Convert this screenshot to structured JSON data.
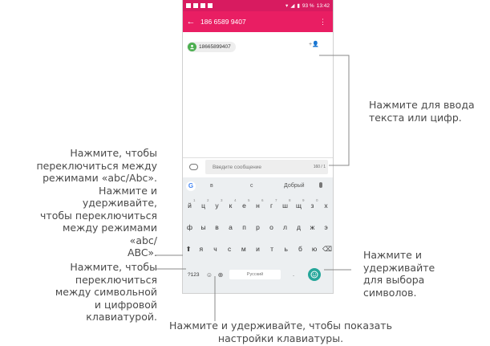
{
  "phone": {
    "status": {
      "battery": "93 %",
      "time": "13:42"
    },
    "appbar": {
      "title": "186 6589 9407",
      "back": "←",
      "menu": "⋮"
    },
    "recipient": {
      "number": "18665899407",
      "add_icon": "+👤"
    },
    "compose": {
      "placeholder": "Введите сообщение",
      "counter": "160 / 1"
    },
    "keyboard": {
      "suggestions": [
        "в",
        "с",
        "Добрый"
      ],
      "row1": [
        {
          "k": "й",
          "s": "1"
        },
        {
          "k": "ц",
          "s": "2"
        },
        {
          "k": "у",
          "s": "3"
        },
        {
          "k": "к",
          "s": "4"
        },
        {
          "k": "е",
          "s": "5"
        },
        {
          "k": "н",
          "s": "6"
        },
        {
          "k": "г",
          "s": "7"
        },
        {
          "k": "ш",
          "s": "8"
        },
        {
          "k": "щ",
          "s": "9"
        },
        {
          "k": "з",
          "s": "0"
        },
        {
          "k": "х",
          "s": ""
        }
      ],
      "row2": [
        "ф",
        "ы",
        "в",
        "а",
        "п",
        "р",
        "о",
        "л",
        "д",
        "ж",
        "э"
      ],
      "row3": [
        "я",
        "ч",
        "с",
        "м",
        "и",
        "т",
        "ь",
        "б",
        "ю"
      ],
      "symbols_key": "?123",
      "space_label": "Русский",
      "period": "."
    }
  },
  "callouts": {
    "right_top": "Нажмите для ввода\nтекста или цифр.",
    "left_top": "Нажмите, чтобы\nпереключиться между\nрежимами «abc/Abc».\nНажмите и удерживайте,\nчтобы переключиться\nмежду режимами «abc/\nABC».",
    "left_bottom": "Нажмите, чтобы\nпереключиться\nмежду символьной\nи цифровой\nклавиатурой.",
    "right_bottom": "Нажмите и\nудерживайте\nдля выбора\nсимволов.",
    "bottom": "Нажмите и удерживайте, чтобы показать\nнастройки клавиатуры."
  },
  "colors": {
    "statusbar": "#d81b60",
    "appbar": "#e91e63",
    "avatar": "#4caf50",
    "emoji_key": "#26a69a"
  },
  "icons": {
    "back": "arrow-back-icon",
    "menu": "more-vert-icon",
    "avatar": "person-icon",
    "add_contact": "add-contact-icon",
    "attach": "attachment-icon",
    "mic": "mic-icon",
    "shift": "shift-icon",
    "backspace": "backspace-icon",
    "settings": "mic-settings-icon",
    "globe": "globe-icon",
    "emoji": "emoji-icon"
  }
}
